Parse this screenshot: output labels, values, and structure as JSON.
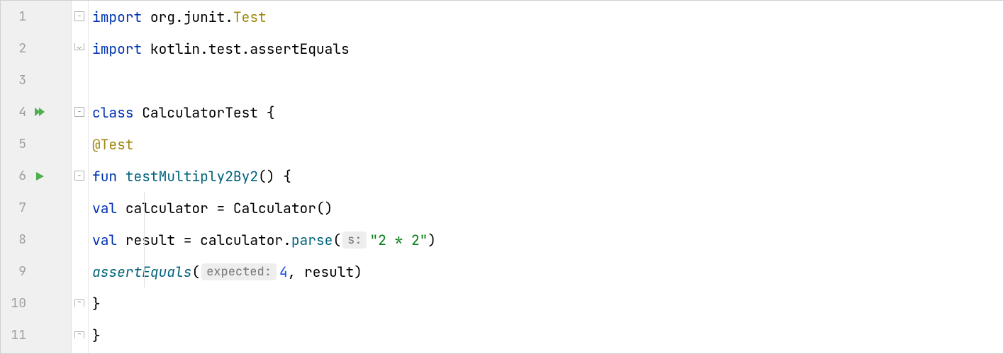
{
  "lines": [
    "1",
    "2",
    "3",
    "4",
    "5",
    "6",
    "7",
    "8",
    "9",
    "10",
    "11"
  ],
  "code": {
    "l1": {
      "import": "import ",
      "pkg": "org.junit.",
      "cls": "Test"
    },
    "l2": {
      "import": "import ",
      "pkg": "kotlin.test.",
      "fn": "assertEquals"
    },
    "l4": {
      "kw": "class ",
      "name": "CalculatorTest ",
      "brace": "{"
    },
    "l5": {
      "annot": "@Test"
    },
    "l6": {
      "kw": "fun ",
      "fn": "testMultiply2By2",
      "rest": "() {"
    },
    "l7": {
      "kw": "val ",
      "name": "calculator = Calculator()"
    },
    "l8": {
      "kw": "val ",
      "name": "result = calculator.",
      "method": "parse",
      "open": "(",
      "hint": "s:",
      "str": "\"2 * 2\"",
      "close": ")"
    },
    "l9": {
      "fn": "assertEquals",
      "open": "(",
      "hint": "expected:",
      "num": "4",
      "rest": ", result)"
    },
    "l10": {
      "brace": "}"
    },
    "l11": {
      "brace": "}"
    }
  }
}
